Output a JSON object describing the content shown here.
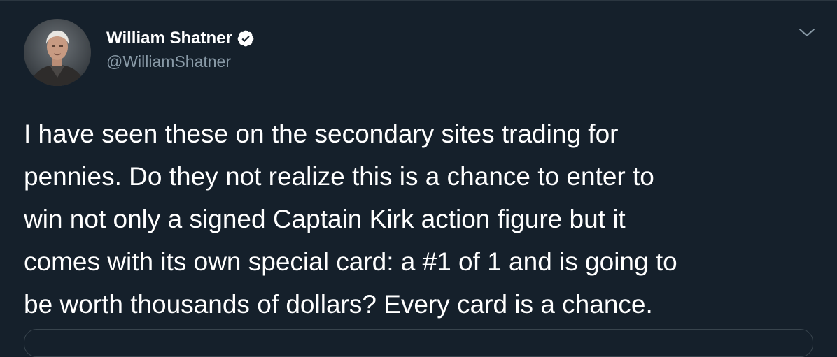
{
  "author": {
    "display_name": "William Shatner",
    "handle": "@WilliamShatner",
    "verified": true,
    "avatar_icon": "profile-photo-avatar"
  },
  "tweet": {
    "text_lines": [
      "I have seen these on the secondary sites trading for",
      "pennies. Do they not realize this is a chance to enter to",
      "win not only a signed Captain Kirk action figure but it",
      "comes with its own special card: a #1 of 1 and is going to",
      "be worth thousands of dollars? Every card is a chance."
    ]
  },
  "icons": {
    "verified": "verified-badge-icon",
    "menu": "chevron-down-icon"
  },
  "colors": {
    "background": "#15202b",
    "text_primary": "#ffffff",
    "text_secondary": "#8899a6",
    "border": "#38444d"
  }
}
